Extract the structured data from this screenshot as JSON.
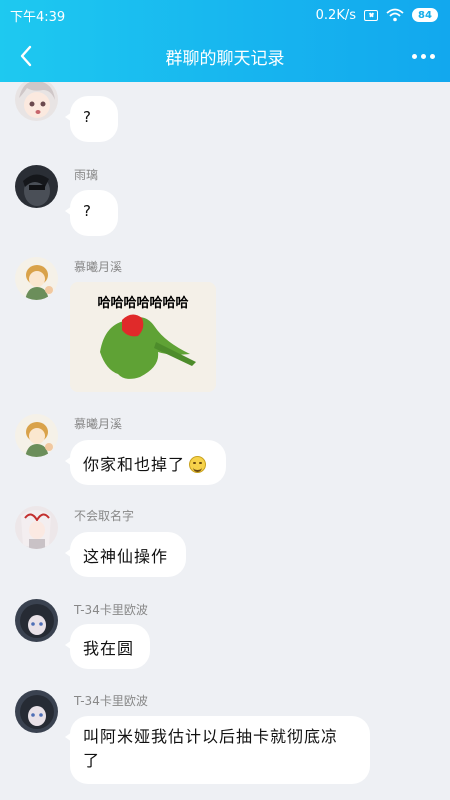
{
  "status": {
    "time": "下午4:39",
    "speed": "0.2K/s",
    "battery": "84",
    "sim_icon": "sim-blocked-icon",
    "wifi_icon": "wifi-icon"
  },
  "header": {
    "title": "群聊的聊天记录",
    "back_icon": "chevron-left-icon",
    "more_icon": "more-dots-icon"
  },
  "messages": [
    {
      "nick": "",
      "text": "?"
    },
    {
      "nick": "雨璃",
      "text": "?"
    },
    {
      "nick": "慕曦月溪",
      "sticker_text": "哈哈哈哈哈哈哈"
    },
    {
      "nick": "慕曦月溪",
      "text": "你家和也掉了"
    },
    {
      "nick": "不会取名字",
      "text": "这神仙操作"
    },
    {
      "nick": "T-34卡里欧波",
      "text": "我在圆"
    },
    {
      "nick": "T-34卡里欧波",
      "text_line1": "叫阿米娅我估计以后抽卡就彻底凉",
      "text_line2": "了"
    }
  ],
  "colors": {
    "header_start": "#1ec9f0",
    "header_end": "#12a8ee",
    "background": "#eef0f4",
    "bubble": "#ffffff"
  }
}
